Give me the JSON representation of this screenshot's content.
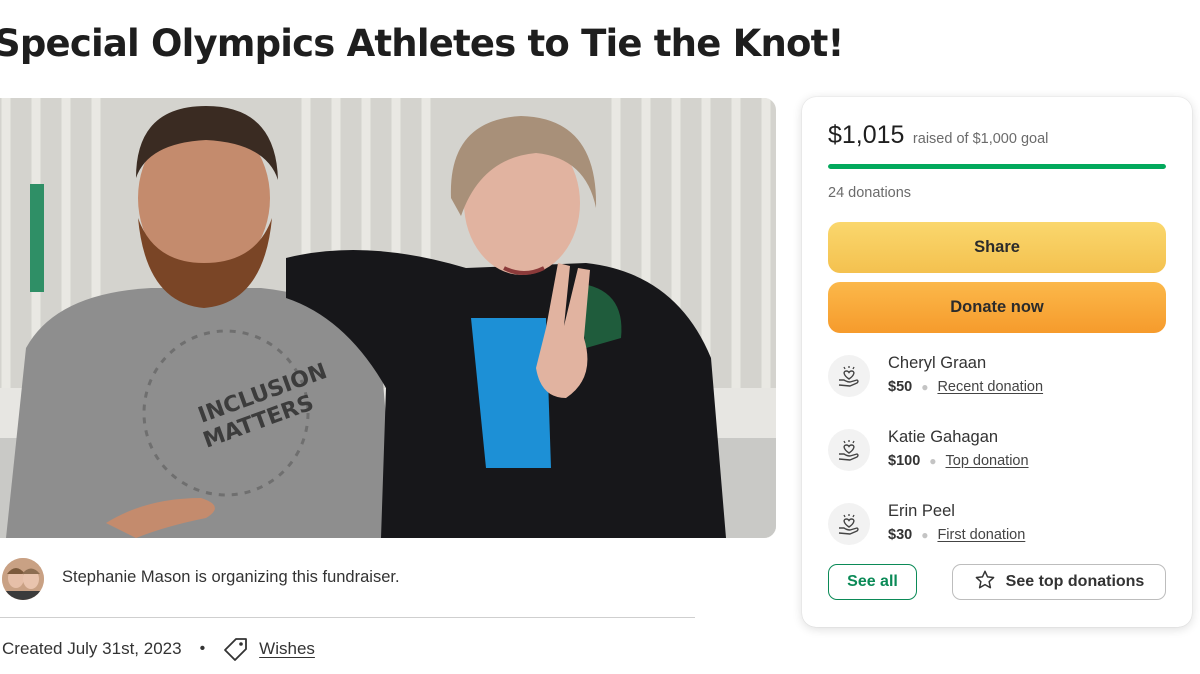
{
  "page": {
    "title": "Special Olympics Athletes to Tie the Knot!"
  },
  "photo": {
    "shirt_text_line1": "INCLUSION",
    "shirt_text_line2": "MATTERS"
  },
  "organizer": {
    "text": "Stephanie Mason is organizing this fundraiser."
  },
  "meta": {
    "created": "Created July 31st, 2023",
    "separator": "•",
    "category": "Wishes",
    "category_icon": "tag-icon"
  },
  "donation_card": {
    "amount_raised": "$1,015",
    "goal_text": "raised of $1,000 goal",
    "progress_fraction": 1.0,
    "donation_count": "24 donations",
    "share_label": "Share",
    "donate_label": "Donate now",
    "donors": [
      {
        "name": "Cheryl Graan",
        "amount": "$50",
        "type": "Recent donation",
        "icon": "heart-hand-icon"
      },
      {
        "name": "Katie Gahagan",
        "amount": "$100",
        "type": "Top donation",
        "icon": "heart-hand-icon"
      },
      {
        "name": "Erin Peel",
        "amount": "$30",
        "type": "First donation",
        "icon": "heart-hand-icon"
      }
    ],
    "see_all_label": "See all",
    "see_top_label": "See top donations",
    "see_top_icon": "star-icon"
  },
  "colors": {
    "progress_green": "#02a95c",
    "share_yellow": "#f4c14f",
    "donate_orange": "#f69b2c",
    "see_all_green": "#0b8a57"
  }
}
